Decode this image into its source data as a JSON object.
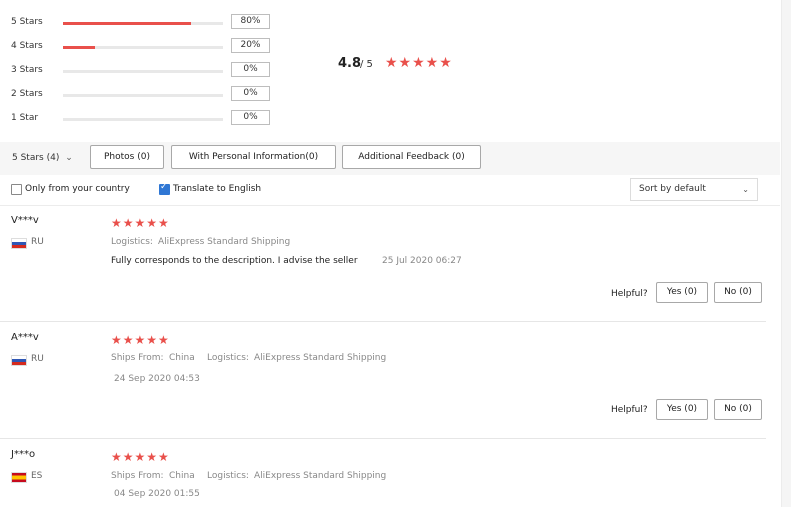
{
  "rating_summary": {
    "rows": [
      {
        "label": "5 Stars",
        "percent": "80%",
        "fill": 0.8
      },
      {
        "label": "4 Stars",
        "percent": "20%",
        "fill": 0.2
      },
      {
        "label": "3 Stars",
        "percent": "0%",
        "fill": 0
      },
      {
        "label": "2 Stars",
        "percent": "0%",
        "fill": 0
      },
      {
        "label": "1 Star",
        "percent": "0%",
        "fill": 0
      }
    ],
    "average": "4.8",
    "out_of": "/ 5",
    "stars": "★★★★★"
  },
  "filters": {
    "star_filter": "5 Stars (4)",
    "star_filter_chevron": "⌄",
    "photos": "Photos (0)",
    "personal_info": "With Personal Information(0)",
    "additional_feedback": "Additional Feedback (0)"
  },
  "options": {
    "only_country_label": "Only from your country",
    "only_country_checked": false,
    "translate_label": "Translate to English",
    "translate_checked": true,
    "sort_label": "Sort by default",
    "sort_chevron": "⌄"
  },
  "reviews": [
    {
      "name": "V***v",
      "country": "RU",
      "stars": "★★★★★",
      "logistics_label": "Logistics:",
      "logistics_value": "AliExpress Standard Shipping",
      "text": "Fully corresponds to the description. I advise the seller",
      "date": "25 Jul 2020 06:27",
      "helpful_label": "Helpful?",
      "yes_label": "Yes (0)",
      "no_label": "No (0)"
    },
    {
      "name": "A***v",
      "country": "RU",
      "stars": "★★★★★",
      "ships_label": "Ships From:",
      "ships_value": "China",
      "logistics_label": "Logistics:",
      "logistics_value": "AliExpress Standard Shipping",
      "date": "24 Sep 2020 04:53",
      "helpful_label": "Helpful?",
      "yes_label": "Yes (0)",
      "no_label": "No (0)"
    },
    {
      "name": "J***o",
      "country": "ES",
      "stars": "★★★★★",
      "ships_label": "Ships From:",
      "ships_value": "China",
      "logistics_label": "Logistics:",
      "logistics_value": "AliExpress Standard Shipping",
      "date": "04 Sep 2020 01:55"
    }
  ],
  "colors": {
    "accent_red": "#e9504b",
    "checkbox_blue": "#2f77d4"
  }
}
